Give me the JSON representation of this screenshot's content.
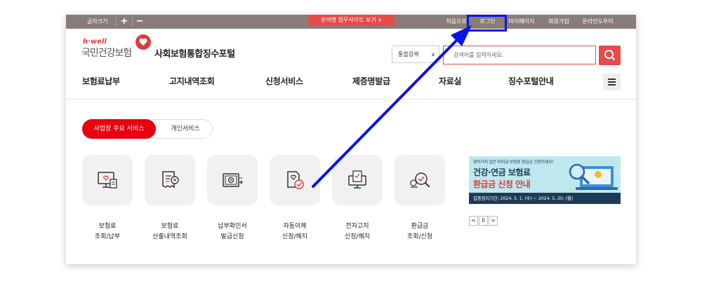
{
  "topbar": {
    "font_size_label": "글자크기",
    "plus": "+",
    "minus": "−",
    "view_button": "분야별 업무사이트 보기 ∨",
    "links": [
      "처음으로",
      "로그인",
      "마이페이지",
      "회원가입",
      "온라인도우미"
    ]
  },
  "header": {
    "logo_sub": "h·well",
    "logo_main": "국민건강보험",
    "portal_title": "사회보험통합징수포털",
    "search_select": "통합검색",
    "search_placeholder": "검색어를 입력하세요."
  },
  "nav": {
    "items": [
      "보험료납부",
      "고지내역조회",
      "신청서비스",
      "제증명발급",
      "자료실",
      "징수포털안내"
    ]
  },
  "tabs": {
    "active": "사업장 주요 서비스",
    "inactive": "개인서비스"
  },
  "services": [
    {
      "line1": "보험료",
      "line2": "조회/납부",
      "icon": "monitor-receipt-icon"
    },
    {
      "line1": "보험료",
      "line2": "산출내역조회",
      "icon": "receipt-search-icon"
    },
    {
      "line1": "납부확인서",
      "line2": "발급신청",
      "icon": "certificate-icon"
    },
    {
      "line1": "자동이체",
      "line2": "신청/해지",
      "icon": "autopay-icon"
    },
    {
      "line1": "전자고지",
      "line2": "신청/해지",
      "icon": "e-notice-icon"
    },
    {
      "line1": "환급금",
      "line2": "조회/신청",
      "icon": "refund-search-icon"
    }
  ],
  "banner": {
    "top_text": "찾아가지 않은 미지급 보험료 환급금 신청하세요!",
    "title1": "건강·연금 보험료",
    "title2": "환급금 신청 안내",
    "date": "집중정리기간: 2024. 5. 1. (수) ~ 2024. 5. 20. (월)"
  },
  "banner_controls": {
    "prev": "<",
    "pause": "II",
    "next": ">"
  },
  "colors": {
    "topbar": "#8a7d78",
    "accent": "#e60012",
    "highlight": "#0a14e6"
  }
}
